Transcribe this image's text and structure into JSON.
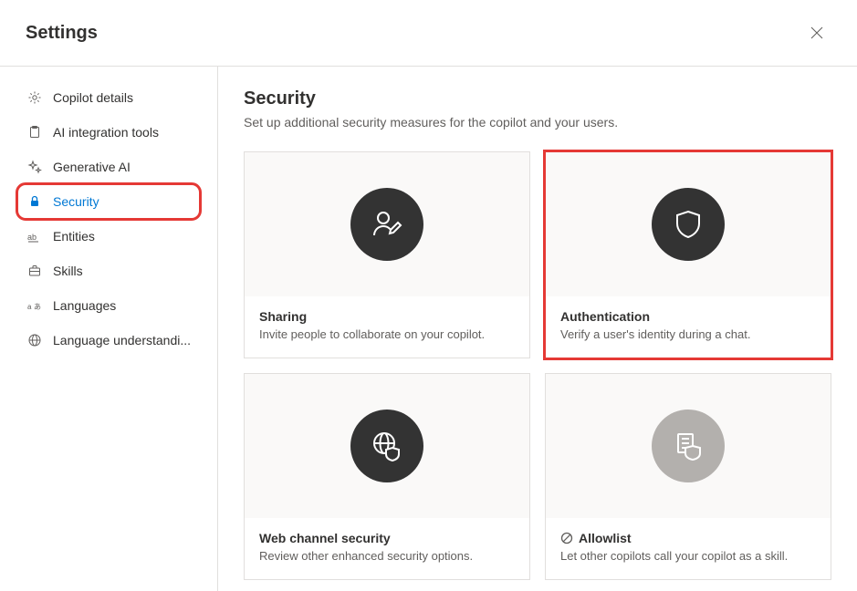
{
  "header": {
    "title": "Settings"
  },
  "sidebar": {
    "items": [
      {
        "label": "Copilot details"
      },
      {
        "label": "AI integration tools"
      },
      {
        "label": "Generative AI"
      },
      {
        "label": "Security"
      },
      {
        "label": "Entities"
      },
      {
        "label": "Skills"
      },
      {
        "label": "Languages"
      },
      {
        "label": "Language understandi..."
      }
    ]
  },
  "main": {
    "title": "Security",
    "subtitle": "Set up additional security measures for the copilot and your users.",
    "cards": [
      {
        "title": "Sharing",
        "desc": "Invite people to collaborate on your copilot."
      },
      {
        "title": "Authentication",
        "desc": "Verify a user's identity during a chat."
      },
      {
        "title": "Web channel security",
        "desc": "Review other enhanced security options."
      },
      {
        "title": "Allowlist",
        "desc": "Let other copilots call your copilot as a skill."
      }
    ]
  }
}
